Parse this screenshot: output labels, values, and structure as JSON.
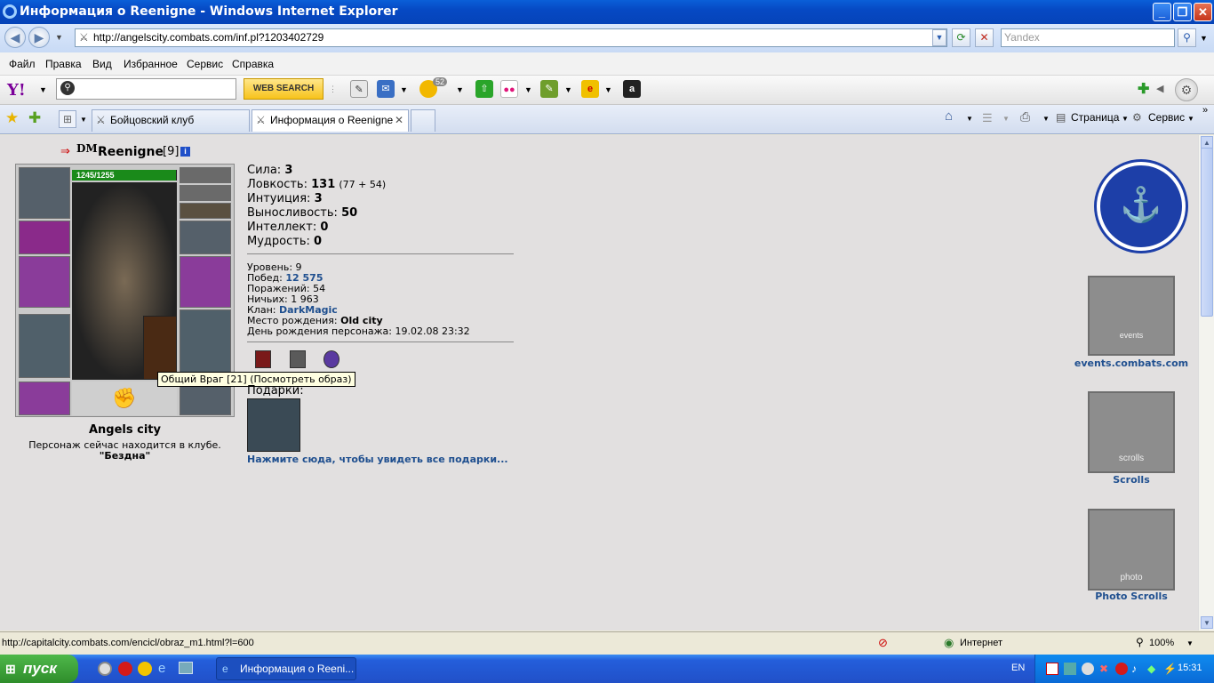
{
  "window": {
    "title": "Информация о Reenigne - Windows Internet Explorer"
  },
  "address": {
    "url": "http://angelscity.combats.com/inf.pl?1203402729",
    "search_placeholder": "Yandex"
  },
  "menu": [
    "Файл",
    "Правка",
    "Вид",
    "Избранное",
    "Сервис",
    "Справка"
  ],
  "yahoo": {
    "logo": "Y!",
    "web_search": "WEB SEARCH",
    "mail_badge": "52"
  },
  "tabs": [
    {
      "label": "Бойцовский клуб",
      "active": false
    },
    {
      "label": "Информация о Reenigne",
      "active": true
    }
  ],
  "commands": {
    "page": "Страница",
    "service": "Сервис"
  },
  "character": {
    "name": "Reenigne",
    "level_tag": "[9]",
    "hp": "1245/1255",
    "hp_fraction": 0.992,
    "city": "Angels city",
    "location_line1": "Персонаж сейчас находится в клубе.",
    "location_line2": "\"Бездна\"",
    "tooltip": "Общий Враг [21] (Посмотреть образ)"
  },
  "stats": [
    {
      "label": "Сила:",
      "value": "3",
      "extra": ""
    },
    {
      "label": "Ловкость:",
      "value": "131",
      "extra": "(77 + 54)"
    },
    {
      "label": "Интуиция:",
      "value": "3",
      "extra": ""
    },
    {
      "label": "Выносливость:",
      "value": "50",
      "extra": ""
    },
    {
      "label": "Интеллект:",
      "value": "0",
      "extra": ""
    },
    {
      "label": "Мудрость:",
      "value": "0",
      "extra": ""
    }
  ],
  "info": {
    "level": "Уровень: 9",
    "wins_label": "Побед:",
    "wins": "12 575",
    "losses": "Поражений: 54",
    "draws": "Ничьих: 1 963",
    "clan_label": "Клан:",
    "clan": "DarkMagic",
    "birthplace_label": "Место рождения:",
    "birthplace": "Old city",
    "birthday": "День рождения персонажа: 19.02.08 23:32"
  },
  "gifts": {
    "label": "Подарки:",
    "link": "Нажмите сюда, чтобы увидеть все подарки..."
  },
  "sidebar": [
    {
      "label": "events.combats.com",
      "banner_text": "events"
    },
    {
      "label": "Scrolls",
      "banner_text": "scrolls"
    },
    {
      "label": "Photo Scrolls",
      "banner_text": "photo"
    }
  ],
  "status": {
    "url": "http://capitalcity.combats.com/encicl/obraz_m1.html?l=600",
    "zone": "Интернет",
    "zoom": "100%"
  },
  "taskbar": {
    "start": "пуск",
    "window": "Информация о Reeni...",
    "lang": "EN",
    "clock": "15:31"
  }
}
